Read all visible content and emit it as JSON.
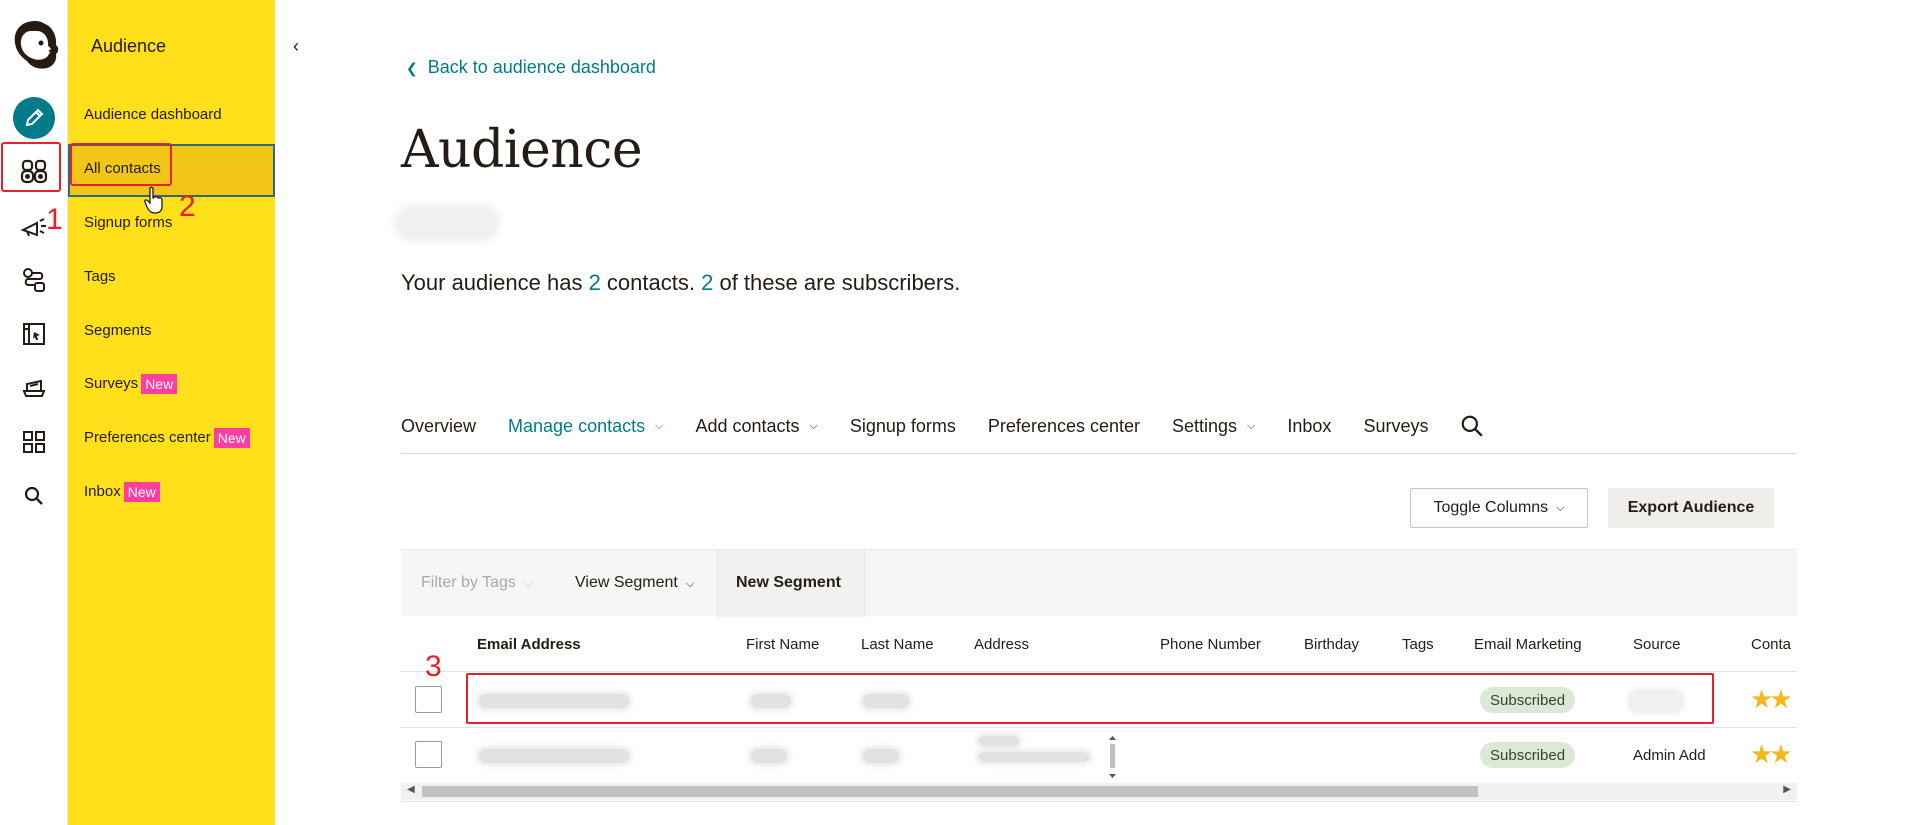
{
  "rail": {
    "icons": [
      "mailchimp-logo",
      "pencil-icon",
      "audience-icon",
      "campaigns-icon",
      "automations-icon",
      "website-icon",
      "content-icon",
      "integrations-icon",
      "search-icon"
    ]
  },
  "subnav": {
    "title": "Audience",
    "collapse_icon": "‹",
    "items": [
      {
        "label": "Audience dashboard"
      },
      {
        "label": "All contacts"
      },
      {
        "label": "Signup forms"
      },
      {
        "label": "Tags"
      },
      {
        "label": "Segments"
      },
      {
        "label": "Surveys",
        "badge": "New"
      },
      {
        "label": "Preferences center",
        "badge": "New"
      },
      {
        "label": "Inbox",
        "badge": "New"
      }
    ]
  },
  "annotations": {
    "one": "1",
    "two": "2",
    "three": "3"
  },
  "main": {
    "back_link": "Back to audience dashboard",
    "title": "Audience",
    "summary_prefix": "Your audience has ",
    "contacts_count": "2",
    "summary_mid": " contacts. ",
    "subscribers_count": "2",
    "summary_suffix": " of these are subscribers."
  },
  "tabs": [
    {
      "label": "Overview"
    },
    {
      "label": "Manage contacts",
      "dropdown": true,
      "active": true
    },
    {
      "label": "Add contacts",
      "dropdown": true
    },
    {
      "label": "Signup forms"
    },
    {
      "label": "Preferences center"
    },
    {
      "label": "Settings",
      "dropdown": true
    },
    {
      "label": "Inbox"
    },
    {
      "label": "Surveys"
    }
  ],
  "buttons": {
    "toggle_columns": "Toggle Columns",
    "export": "Export Audience"
  },
  "filters": {
    "tags": "Filter by Tags",
    "view_segment": "View Segment",
    "new_segment": "New Segment"
  },
  "table": {
    "columns": [
      "Email Address",
      "First Name",
      "Last Name",
      "Address",
      "Phone Number",
      "Birthday",
      "Tags",
      "Email Marketing",
      "Source",
      "Conta"
    ],
    "rows": [
      {
        "email_marketing": "Subscribed",
        "source": ""
      },
      {
        "email_marketing": "Subscribed",
        "source": "Admin Add"
      }
    ]
  },
  "colors": {
    "accent": "#007c89",
    "brand_yellow": "#ffe01b",
    "annotation": "#e5222b",
    "badge": "#ff3da2"
  }
}
